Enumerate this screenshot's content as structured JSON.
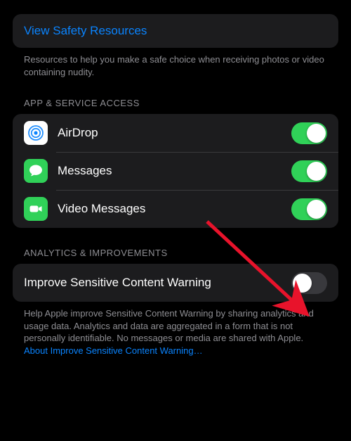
{
  "safety": {
    "link_label": "View Safety Resources",
    "footer": "Resources to help you make a safe choice when receiving photos or video containing nudity."
  },
  "access": {
    "header": "APP & SERVICE ACCESS",
    "items": [
      {
        "label": "AirDrop",
        "enabled": true
      },
      {
        "label": "Messages",
        "enabled": true
      },
      {
        "label": "Video Messages",
        "enabled": true
      }
    ]
  },
  "analytics": {
    "header": "ANALYTICS & IMPROVEMENTS",
    "item_label": "Improve Sensitive Content Warning",
    "enabled": false,
    "footer_plain": "Help Apple improve Sensitive Content Warning by sharing analytics and usage data. Analytics and data are aggregated in a form that is not personally identifiable. No messages or media are shared with Apple. ",
    "footer_link": "About Improve Sensitive Content Warning…"
  },
  "colors": {
    "accent_blue": "#0a84ff",
    "accent_green": "#30d158",
    "card_bg": "#1c1c1e",
    "text_secondary": "#8e8e93"
  }
}
